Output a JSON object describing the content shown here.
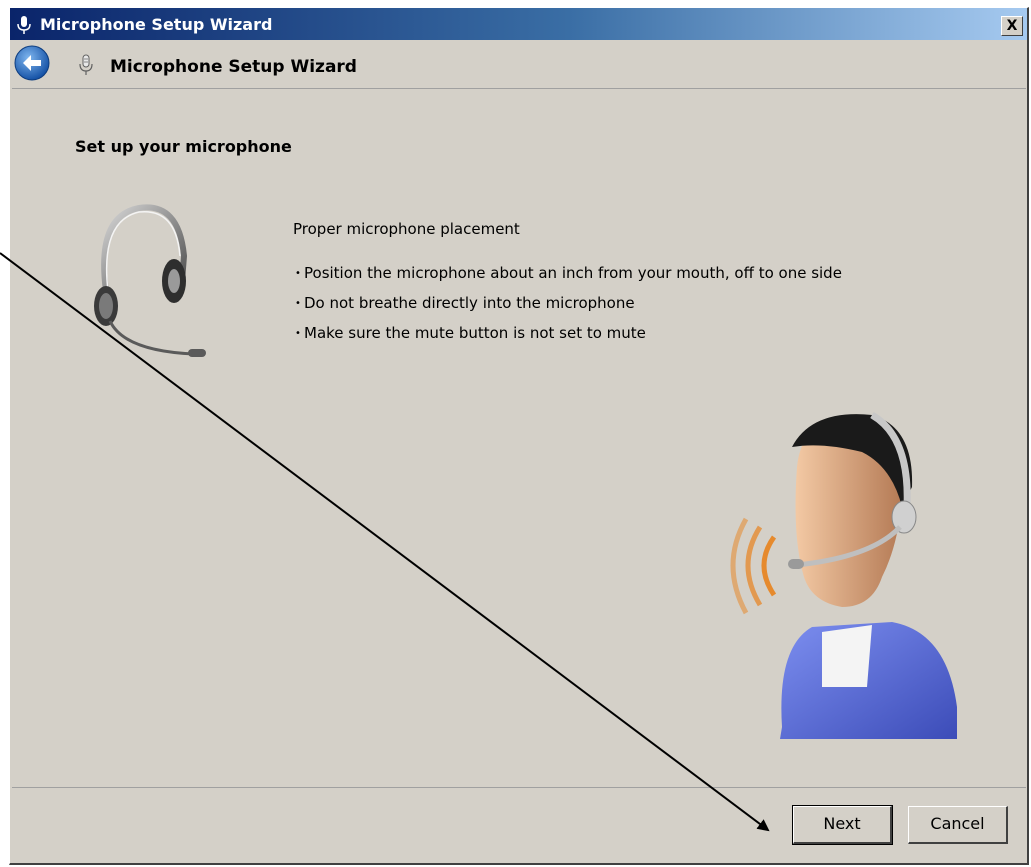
{
  "window": {
    "title": "Microphone Setup Wizard",
    "close_label": "X"
  },
  "navbar": {
    "title": "Microphone Setup Wizard"
  },
  "page": {
    "heading": "Set up your microphone",
    "placement_title": "Proper microphone placement",
    "tips": [
      "Position the microphone about an inch from your mouth, off to one side",
      "Do not breathe directly into the microphone",
      "Make sure the mute button is not set to mute"
    ]
  },
  "buttons": {
    "next": "Next",
    "cancel": "Cancel"
  },
  "icons": {
    "titlebar": "microphone-icon",
    "back": "back-arrow-icon",
    "nav": "microphone-icon",
    "headset": "headset-image",
    "person": "person-with-headset-image"
  },
  "colors": {
    "titlebar_start": "#0a246a",
    "titlebar_end": "#a6caf0",
    "window_bg": "#d4d0c8",
    "back_button": "#1e6fc9",
    "shirt": "#5b6fd6",
    "sound_waves": "#e8821c"
  }
}
